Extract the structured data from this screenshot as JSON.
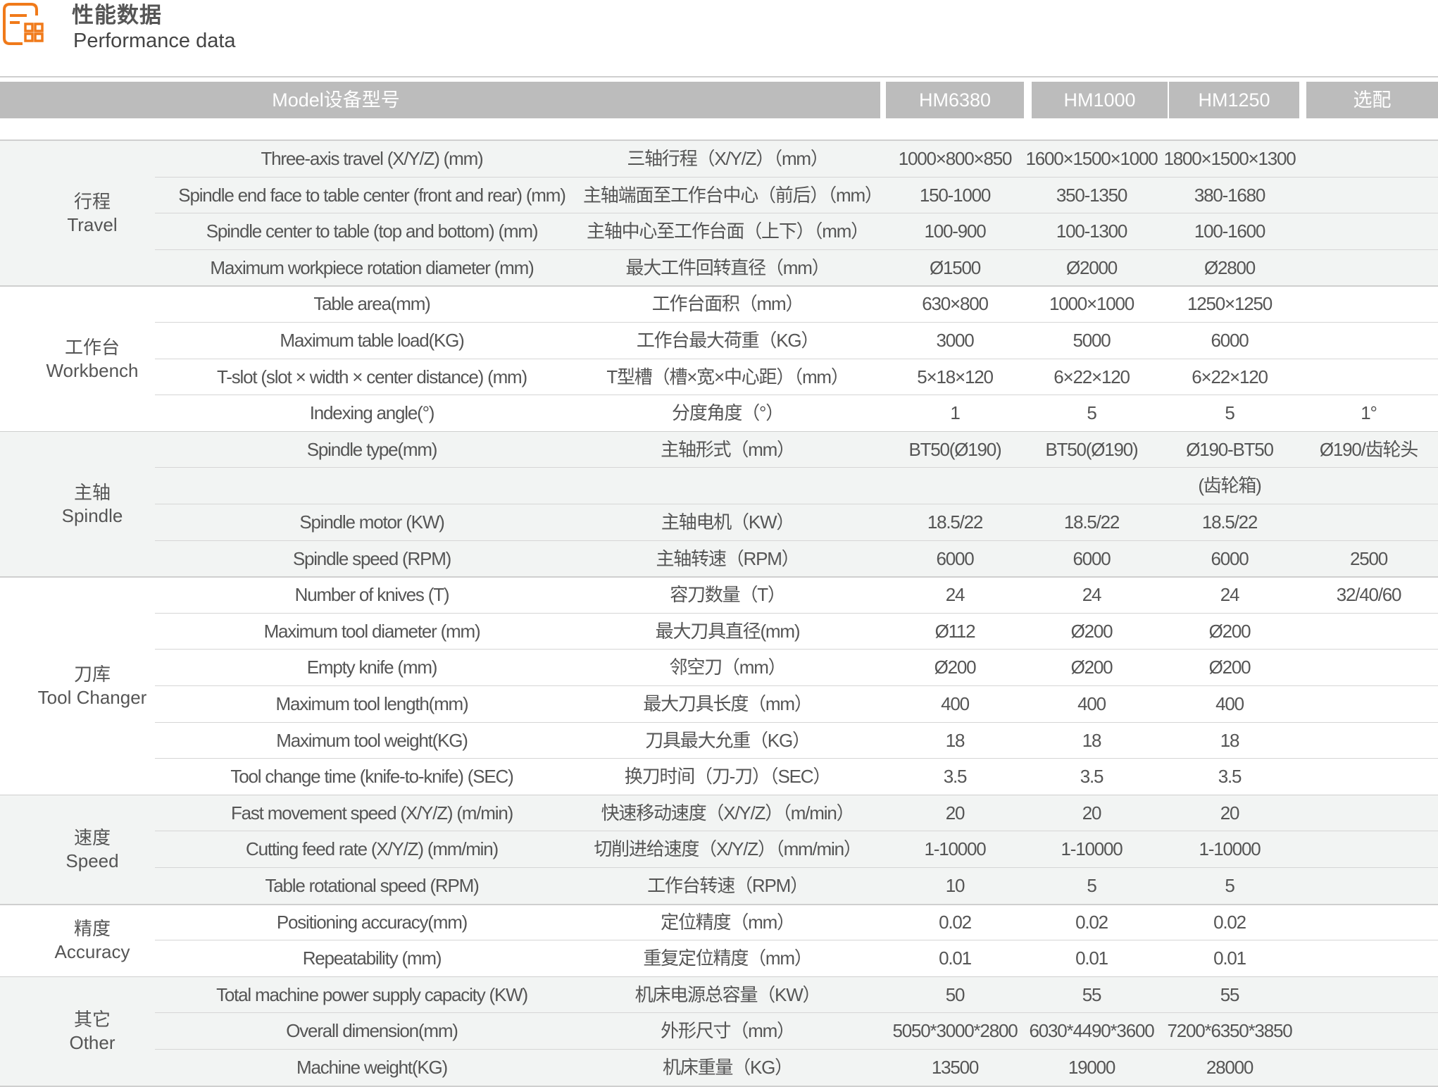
{
  "header": {
    "title_cn": "性能数据",
    "title_en": "Performance data",
    "icon": "spec-sheet-icon",
    "accent_color": "#f07a1a"
  },
  "model_bar": {
    "label": "Model设备型号",
    "models": [
      "HM6380",
      "HM1000",
      "HM1250"
    ],
    "optional": "选配"
  },
  "groups": [
    {
      "cn": "行程",
      "en": "Travel",
      "shaded": true,
      "rows": [
        {
          "en": "Three-axis travel (X/Y/Z) (mm)",
          "cn": "三轴行程（X/Y/Z）（mm）",
          "m1": "1000×800×850",
          "m2": "1600×1500×1000",
          "m3": "1800×1500×1300",
          "opt": ""
        },
        {
          "en": "Spindle end face to table center (front and rear) (mm)",
          "cn": "主轴端面至工作台中心（前后）（mm）",
          "m1": "150-1000",
          "m2": "350-1350",
          "m3": "380-1680",
          "opt": ""
        },
        {
          "en": "Spindle center to table (top and bottom) (mm)",
          "cn": "主轴中心至工作台面（上下）（mm）",
          "m1": "100-900",
          "m2": "100-1300",
          "m3": "100-1600",
          "opt": ""
        },
        {
          "en": "Maximum workpiece rotation diameter (mm)",
          "cn": "最大工件回转直径（mm）",
          "m1": "Ø1500",
          "m2": "Ø2000",
          "m3": "Ø2800",
          "opt": ""
        }
      ]
    },
    {
      "cn": "工作台",
      "en": "Workbench",
      "shaded": false,
      "rows": [
        {
          "en": "Table area(mm)",
          "cn": "工作台面积（mm）",
          "m1": "630×800",
          "m2": "1000×1000",
          "m3": "1250×1250",
          "opt": ""
        },
        {
          "en": "Maximum table load(KG)",
          "cn": "工作台最大荷重（KG）",
          "m1": "3000",
          "m2": "5000",
          "m3": "6000",
          "opt": ""
        },
        {
          "en": "T-slot (slot × width × center distance) (mm)",
          "cn": "T型槽（槽×宽×中心距）（mm）",
          "m1": "5×18×120",
          "m2": "6×22×120",
          "m3": "6×22×120",
          "opt": ""
        },
        {
          "en": "Indexing angle(°)",
          "cn": "分度角度（°）",
          "m1": "1",
          "m2": "5",
          "m3": "5",
          "opt": "1°"
        }
      ]
    },
    {
      "cn": "主轴",
      "en": "Spindle",
      "shaded": true,
      "rows": [
        {
          "en": "Spindle type(mm)",
          "cn": "主轴形式（mm）",
          "m1": "BT50(Ø190)",
          "m2": "BT50(Ø190)",
          "m3": "Ø190-BT50",
          "opt": "Ø190/齿轮头"
        },
        {
          "en": "",
          "cn": "",
          "m1": "",
          "m2": "",
          "m3": "(齿轮箱)",
          "opt": ""
        },
        {
          "en": "Spindle motor (KW)",
          "cn": "主轴电机（KW）",
          "m1": "18.5/22",
          "m2": "18.5/22",
          "m3": "18.5/22",
          "opt": ""
        },
        {
          "en": "Spindle speed (RPM)",
          "cn": "主轴转速（RPM）",
          "m1": "6000",
          "m2": "6000",
          "m3": "6000",
          "opt": "2500"
        }
      ]
    },
    {
      "cn": "刀库",
      "en": "Tool Changer",
      "shaded": false,
      "rows": [
        {
          "en": "Number of knives (T)",
          "cn": "容刀数量（T）",
          "m1": "24",
          "m2": "24",
          "m3": "24",
          "opt": "32/40/60"
        },
        {
          "en": "Maximum tool diameter (mm)",
          "cn": "最大刀具直径(mm)",
          "m1": "Ø112",
          "m2": "Ø200",
          "m3": "Ø200",
          "opt": ""
        },
        {
          "en": "Empty knife (mm)",
          "cn": "邻空刀（mm）",
          "m1": "Ø200",
          "m2": "Ø200",
          "m3": "Ø200",
          "opt": ""
        },
        {
          "en": "Maximum tool length(mm)",
          "cn": "最大刀具长度（mm）",
          "m1": "400",
          "m2": "400",
          "m3": "400",
          "opt": ""
        },
        {
          "en": "Maximum tool weight(KG)",
          "cn": "刀具最大允重（KG）",
          "m1": "18",
          "m2": "18",
          "m3": "18",
          "opt": ""
        },
        {
          "en": "Tool change time (knife-to-knife) (SEC)",
          "cn": "换刀时间（刀-刀）（SEC）",
          "m1": "3.5",
          "m2": "3.5",
          "m3": "3.5",
          "opt": ""
        }
      ]
    },
    {
      "cn": "速度",
      "en": "Speed",
      "shaded": true,
      "rows": [
        {
          "en": "Fast movement speed (X/Y/Z) (m/min)",
          "cn": "快速移动速度（X/Y/Z）（m/min）",
          "m1": "20",
          "m2": "20",
          "m3": "20",
          "opt": ""
        },
        {
          "en": "Cutting feed rate (X/Y/Z) (mm/min)",
          "cn": "切削进给速度（X/Y/Z）（mm/min）",
          "m1": "1-10000",
          "m2": "1-10000",
          "m3": "1-10000",
          "opt": ""
        },
        {
          "en": "Table rotational speed (RPM)",
          "cn": "工作台转速（RPM）",
          "m1": "10",
          "m2": "5",
          "m3": "5",
          "opt": ""
        }
      ]
    },
    {
      "cn": "精度",
      "en": "Accuracy",
      "shaded": false,
      "rows": [
        {
          "en": "Positioning accuracy(mm)",
          "cn": "定位精度（mm）",
          "m1": "0.02",
          "m2": "0.02",
          "m3": "0.02",
          "opt": ""
        },
        {
          "en": "Repeatability (mm)",
          "cn": "重复定位精度（mm）",
          "m1": "0.01",
          "m2": "0.01",
          "m3": "0.01",
          "opt": ""
        }
      ]
    },
    {
      "cn": "其它",
      "en": "Other",
      "shaded": true,
      "rows": [
        {
          "en": "Total machine power supply capacity (KW)",
          "cn": "机床电源总容量（KW）",
          "m1": "50",
          "m2": "55",
          "m3": "55",
          "opt": ""
        },
        {
          "en": "Overall dimension(mm)",
          "cn": "外形尺寸（mm）",
          "m1": "5050*3000*2800",
          "m2": "6030*4490*3600",
          "m3": "7200*6350*3850",
          "opt": ""
        },
        {
          "en": "Machine weight(KG)",
          "cn": "机床重量（KG）",
          "m1": "13500",
          "m2": "19000",
          "m3": "28000",
          "opt": ""
        }
      ]
    }
  ]
}
